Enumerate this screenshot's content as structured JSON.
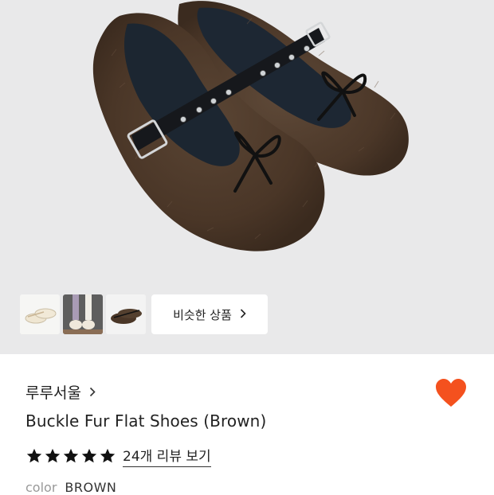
{
  "gallery": {
    "main_image": "brown-fur-buckle-flat-shoes-photo",
    "thumbnails": [
      {
        "name": "cream-flat-shoes-thumbnail"
      },
      {
        "name": "worn-shoes-thumbnail"
      },
      {
        "name": "brown-fur-shoes-thumbnail"
      }
    ],
    "similar_button_label": "비슷한 상품"
  },
  "product": {
    "brand": "루루서울",
    "title": "Buckle Fur Flat Shoes (Brown)",
    "rating_stars": 5,
    "review_link": "24개 리뷰 보기",
    "option_label": "color",
    "option_value": "BROWN",
    "favorited": true
  },
  "colors": {
    "heart": "#f4511e",
    "star": "#111111",
    "background_hero": "#e9e9ea"
  }
}
